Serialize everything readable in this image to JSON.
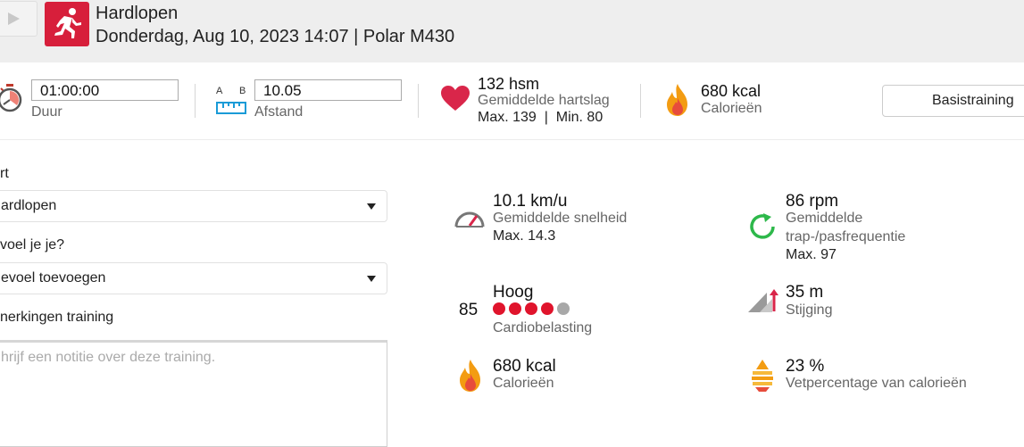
{
  "header": {
    "title": "Hardlopen",
    "subtitle": "Donderdag, Aug 10, 2023 14:07 | Polar M430",
    "sport_icon": "running-person-icon",
    "accent_color": "#d71f3b"
  },
  "summary": {
    "duration": {
      "value": "01:00:00",
      "label": "Duur"
    },
    "distance": {
      "a_label": "A",
      "b_label": "B",
      "value": "10.05",
      "label": "Afstand"
    },
    "heart_rate": {
      "value": "132 hsm",
      "label": "Gemiddelde hartslag",
      "minmax": "Max. 139  |  Min. 80"
    },
    "calories": {
      "value": "680 kcal",
      "label": "Calorieën"
    },
    "training_button": "Basistraining"
  },
  "form": {
    "sport_label": "rt",
    "sport_value": "ardlopen",
    "feeling_label": " voel je je?",
    "feeling_value": "evoel toevoegen",
    "notes_label": "nerkingen training",
    "notes_placeholder": "hrijf een notitie over deze training."
  },
  "stats": {
    "speed": {
      "value": "10.1 km/u",
      "label": "Gemiddelde snelheid",
      "sub": "Max. 14.3"
    },
    "cadence": {
      "value": "86 rpm",
      "label1": "Gemiddelde",
      "label2": "trap-/pasfrequentie",
      "sub": "Max. 97"
    },
    "cardio": {
      "score": "85",
      "value": "Hoog",
      "label": "Cardiobelasting",
      "level": 4,
      "level_max": 5
    },
    "ascent": {
      "value": "35 m",
      "label": "Stijging"
    },
    "calories": {
      "value": "680 kcal",
      "label": "Calorieën"
    },
    "fat": {
      "value": "23 %",
      "label": "Vetpercentage van calorieën"
    }
  },
  "colors": {
    "heart": "#d9264a",
    "dots_on": "#e0142c",
    "dots_off": "#a8a8a8",
    "flame": "#f39c12",
    "cadence": "#2db84a"
  }
}
